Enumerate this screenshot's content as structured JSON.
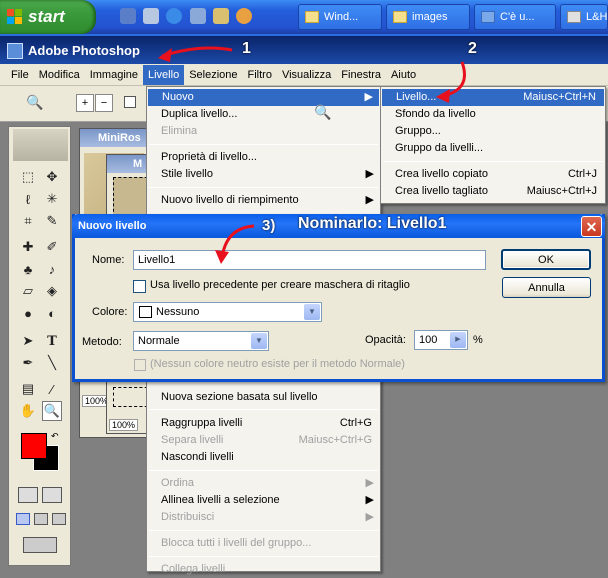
{
  "taskbar": {
    "start_label": "start",
    "buttons": [
      "Wind...",
      "images",
      "C'è u...",
      "L&H P..."
    ]
  },
  "photoshop": {
    "title": "Adobe Photoshop",
    "menu": [
      "File",
      "Modifica",
      "Immagine",
      "Livello",
      "Selezione",
      "Filtro",
      "Visualizza",
      "Finestra",
      "Aiuto"
    ]
  },
  "doc": {
    "title_1": "MiniRos",
    "title_2": "M",
    "zoom_1": "100%",
    "zoom_2": "100%"
  },
  "livello_menu": {
    "items": [
      {
        "label": "Nuovo",
        "submenu": true
      },
      {
        "label": "Duplica livello..."
      },
      {
        "label": "Elimina",
        "disabled": true
      },
      {
        "label": "Proprietà di livello..."
      },
      {
        "label": "Stile livello",
        "submenu": true
      },
      {
        "label": "Nuovo livello di riempimento",
        "submenu": true
      },
      {
        "label": "Nuova sezione basata sul livello"
      },
      {
        "label": "Raggruppa livelli",
        "shortcut": "Ctrl+G"
      },
      {
        "label": "Separa livelli",
        "shortcut": "Maiusc+Ctrl+G",
        "disabled": true
      },
      {
        "label": "Nascondi livelli"
      },
      {
        "label": "Ordina",
        "submenu": true,
        "disabled": true
      },
      {
        "label": "Allinea livelli a selezione",
        "submenu": true
      },
      {
        "label": "Distribuisci",
        "submenu": true,
        "disabled": true
      },
      {
        "label": "Blocca tutti i livelli del gruppo...",
        "disabled": true
      },
      {
        "label": "Collega livelli",
        "disabled": true
      }
    ]
  },
  "nuovo_submenu": {
    "items": [
      {
        "label": "Livello...",
        "shortcut": "Maiusc+Ctrl+N"
      },
      {
        "label": "Sfondo da livello"
      },
      {
        "label": "Gruppo..."
      },
      {
        "label": "Gruppo da livelli..."
      },
      {
        "label": "Crea livello copiato",
        "shortcut": "Ctrl+J"
      },
      {
        "label": "Crea livello tagliato",
        "shortcut": "Maiusc+Ctrl+J"
      }
    ]
  },
  "dialog": {
    "title": "Nuovo livello",
    "name_label": "Nome:",
    "name_value": "Livello1",
    "checkbox_label": "Usa livello precedente per creare maschera di ritaglio",
    "color_label": "Colore:",
    "color_value": "Nessuno",
    "mode_label": "Metodo:",
    "mode_value": "Normale",
    "opacity_label": "Opacità:",
    "opacity_value": "100",
    "opacity_unit": "%",
    "neutral_label": "(Nessun colore neutro esiste per il metodo Normale)",
    "ok_label": "OK",
    "cancel_label": "Annulla"
  },
  "annotations": {
    "step1": "1",
    "step2": "2",
    "step3_prefix": "3)",
    "step3_text": "Nominarlo: Livello1"
  },
  "colors": {
    "accent": "#316ac5",
    "annotation_arrow": "#e8101c",
    "foreground_swatch": "#ff0000",
    "background_swatch": "#000000"
  }
}
